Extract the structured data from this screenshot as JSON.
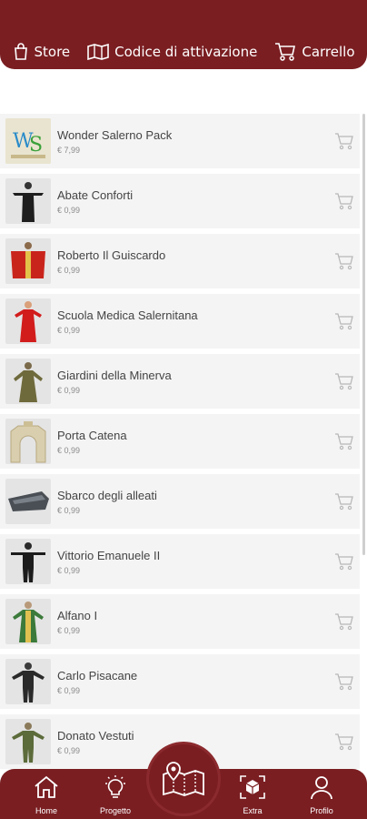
{
  "header": {
    "tabs": [
      {
        "label": "Store",
        "icon": "bag-icon"
      },
      {
        "label": "Codice di attivazione",
        "icon": "map-icon"
      },
      {
        "label": "Carrello",
        "icon": "cart-icon"
      }
    ]
  },
  "products": [
    {
      "title": "Wonder Salerno Pack",
      "price": "€ 7,99",
      "thumb": "wonder-salerno-logo"
    },
    {
      "title": "Abate Conforti",
      "price": "€ 0,99",
      "thumb": "figure-black-robe"
    },
    {
      "title": "Roberto Il Guiscardo",
      "price": "€ 0,99",
      "thumb": "figure-red-cloak"
    },
    {
      "title": "Scuola Medica Salernitana",
      "price": "€ 0,99",
      "thumb": "figure-red-dress"
    },
    {
      "title": "Giardini della Minerva",
      "price": "€ 0,99",
      "thumb": "figure-brown-robe"
    },
    {
      "title": "Porta Catena",
      "price": "€ 0,99",
      "thumb": "gate-arch"
    },
    {
      "title": "Sbarco degli alleati",
      "price": "€ 0,99",
      "thumb": "landing-boat"
    },
    {
      "title": "Vittorio Emanuele II",
      "price": "€ 0,99",
      "thumb": "figure-dark-uniform"
    },
    {
      "title": "Alfano I",
      "price": "€ 0,99",
      "thumb": "figure-green-vestment"
    },
    {
      "title": "Carlo Pisacane",
      "price": "€ 0,99",
      "thumb": "figure-dark-suit"
    },
    {
      "title": "Donato Vestuti",
      "price": "€ 0,99",
      "thumb": "figure-green-uniform"
    }
  ],
  "bottom_nav": [
    {
      "label": "Home",
      "icon": "home-icon"
    },
    {
      "label": "Progetto",
      "icon": "lightbulb-icon"
    },
    {
      "label": "Extra",
      "icon": "ar-box-icon"
    },
    {
      "label": "Profilo",
      "icon": "user-icon"
    }
  ],
  "colors": {
    "brand": "#7a1e22",
    "row_bg": "#f4f4f4"
  }
}
